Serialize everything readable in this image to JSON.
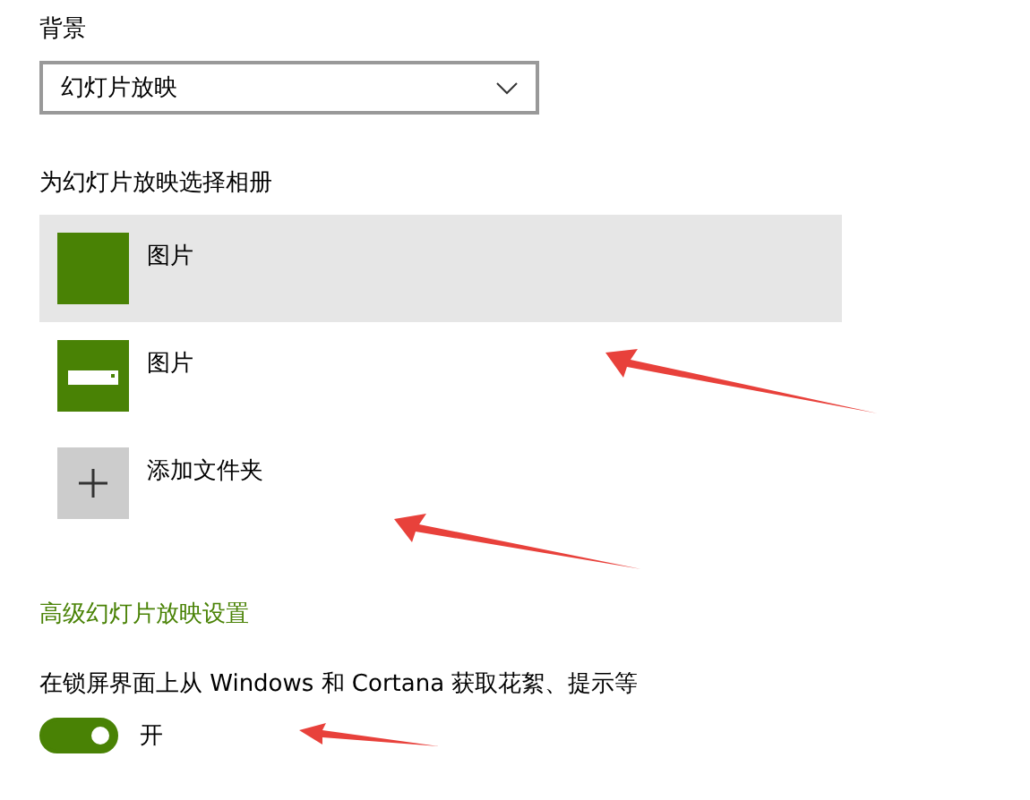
{
  "background": {
    "label": "背景",
    "dropdown": {
      "value": "幻灯片放映"
    }
  },
  "albums": {
    "label": "为幻灯片放映选择相册",
    "items": [
      {
        "kind": "solid",
        "label": "图片",
        "selected": true
      },
      {
        "kind": "drive",
        "label": "图片",
        "selected": false
      },
      {
        "kind": "add",
        "label": "添加文件夹",
        "selected": false
      }
    ]
  },
  "advanced_link": "高级幻灯片放映设置",
  "tips": {
    "label": "在锁屏界面上从 Windows 和 Cortana 获取花絮、提示等",
    "toggle": {
      "on": true,
      "state_label": "开"
    }
  }
}
